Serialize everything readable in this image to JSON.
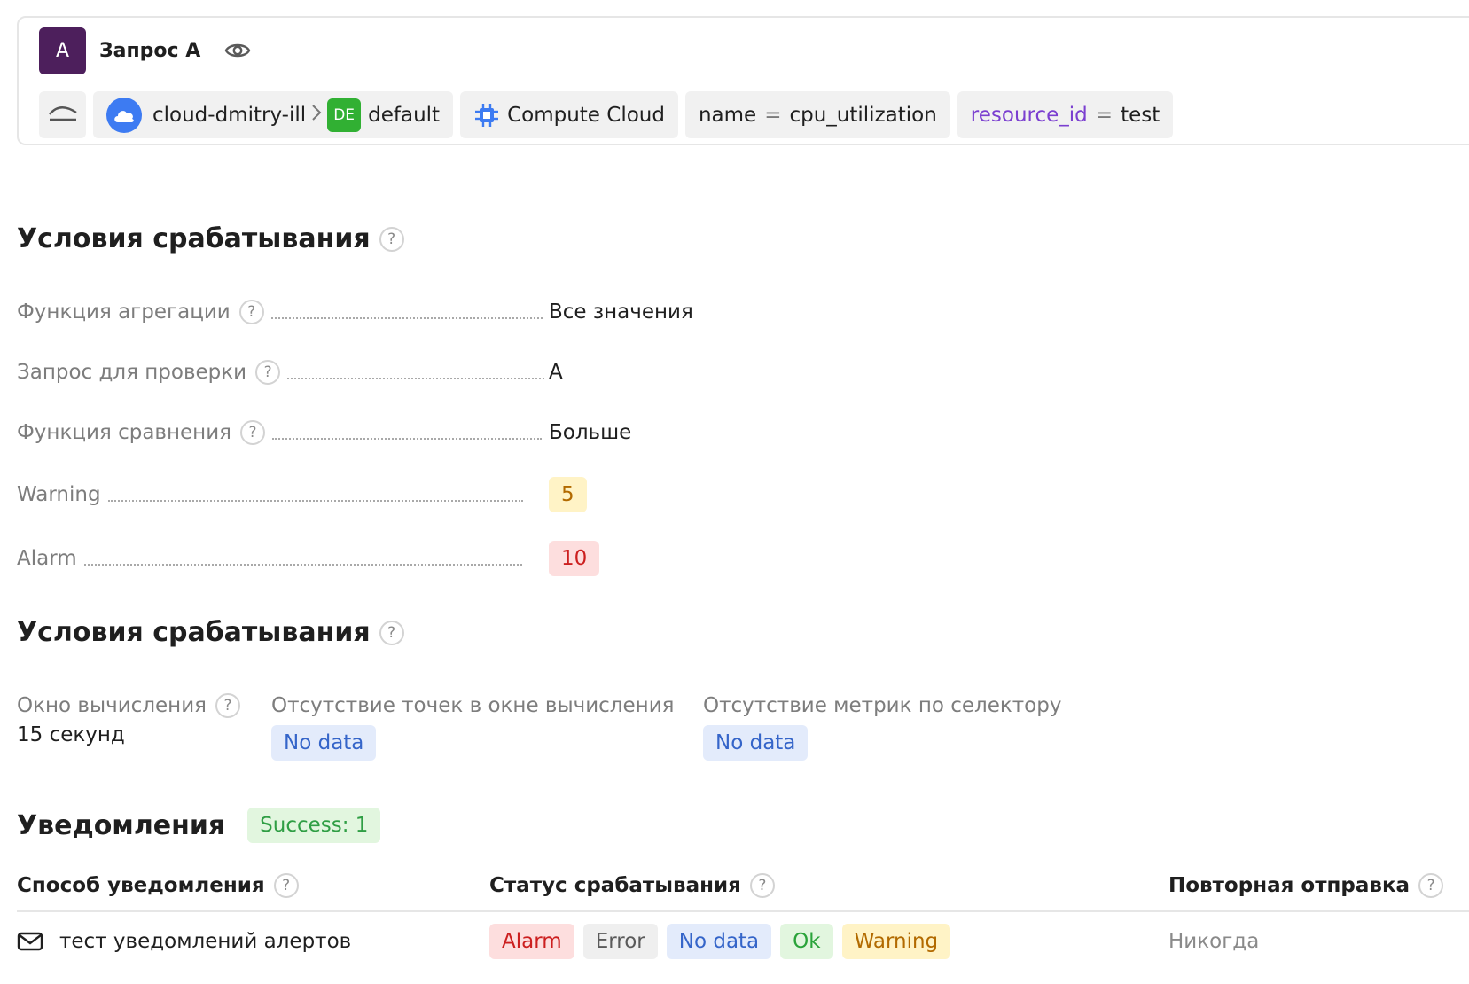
{
  "query": {
    "avatar_letter": "A",
    "title": "Запрос A",
    "chips": {
      "cloud": "cloud-dmitry-ill",
      "folder_badge": "DE",
      "folder": "default",
      "service": "Compute Cloud",
      "name_key": "name",
      "name_op": "=",
      "name_value": "cpu_utilization",
      "resource_key": "resource_id",
      "resource_op": "=",
      "resource_value": "test"
    }
  },
  "conditions": {
    "title": "Условия срабатывания",
    "rows": [
      {
        "label": "Функция агрегации",
        "value": "Все значения"
      },
      {
        "label": "Запрос для проверки",
        "value": "A"
      },
      {
        "label": "Функция сравнения",
        "value": "Больше"
      },
      {
        "label": "Warning",
        "value": "5"
      },
      {
        "label": "Alarm",
        "value": "10"
      }
    ]
  },
  "conditions2": {
    "title": "Условия срабатывания",
    "window_label": "Окно вычисления",
    "window_value": "15 секунд",
    "no_points_label": "Отсутствие точек в окне вычисления",
    "no_points_value": "No data",
    "no_metrics_label": "Отсутствие метрик по селектору",
    "no_metrics_value": "No data"
  },
  "notifications": {
    "title": "Уведомления",
    "success_badge": "Success: 1",
    "col_method": "Способ уведомления",
    "col_status": "Статус срабатывания",
    "col_resend": "Повторная отправка",
    "row": {
      "method": "тест уведомлений алертов",
      "statuses": [
        "Alarm",
        "Error",
        "No data",
        "Ok",
        "Warning"
      ],
      "resend": "Никогда"
    }
  },
  "colors": {
    "avatar": "#4d1f5c",
    "warning_bg": "#fff3c6",
    "alarm_bg": "#fddede",
    "nodata_bg": "#e3ebfb",
    "success_bg": "#e2f6df"
  },
  "icons": [
    "eye-icon",
    "area-chart-icon",
    "cloud-icon",
    "chevron-right-icon",
    "chip-icon",
    "help-icon",
    "mail-icon"
  ]
}
